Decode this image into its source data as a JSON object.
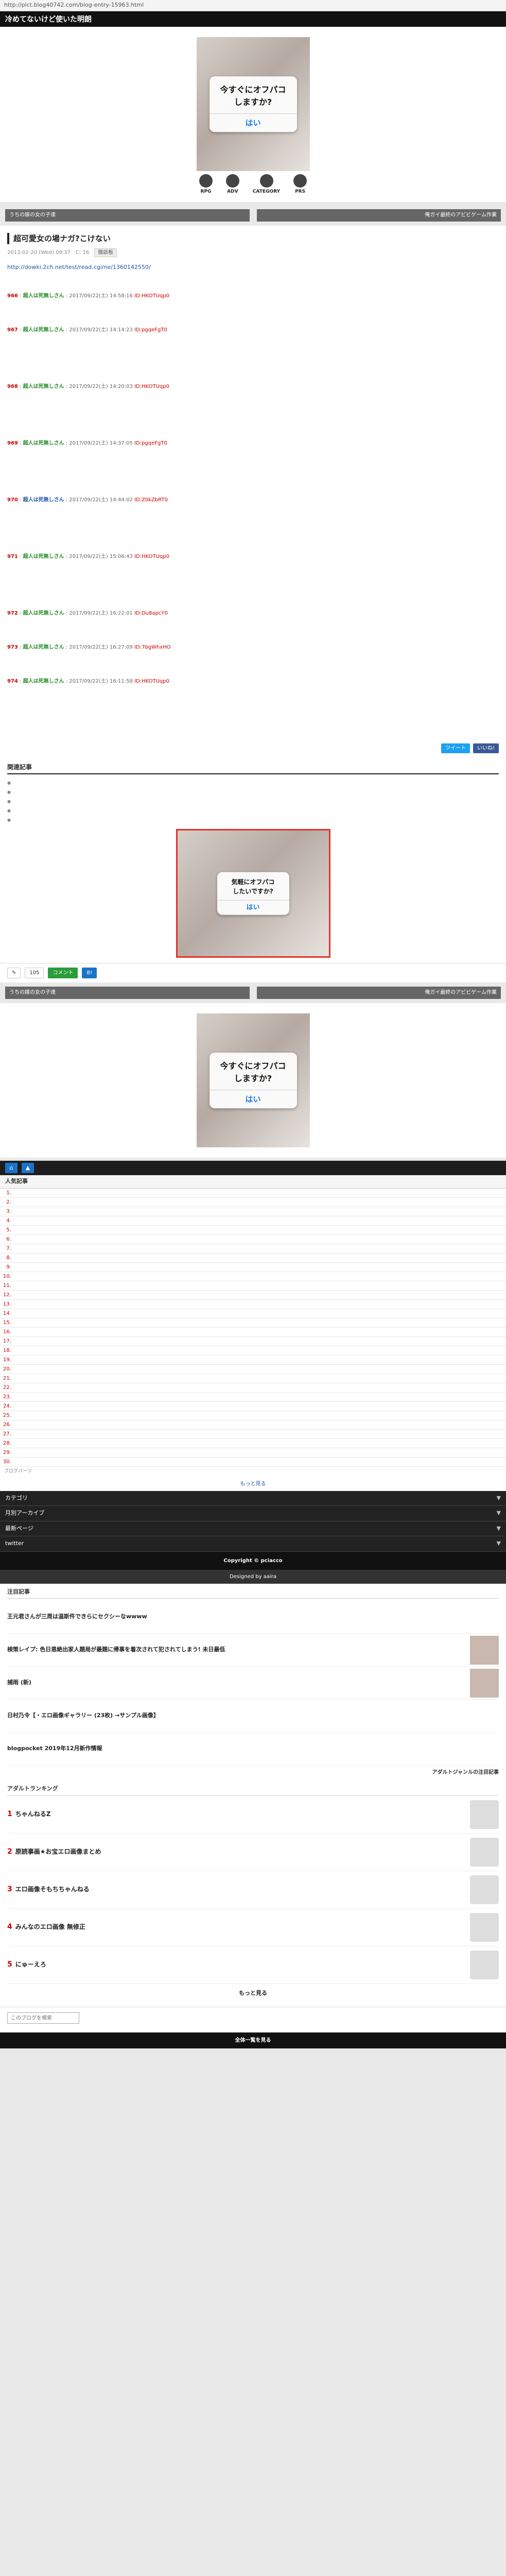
{
  "browser": {
    "url": "http://pict.blog40742.com/blog-entry-15963.html"
  },
  "site": {
    "title": "冷めてないけど使いた明朗"
  },
  "ad": {
    "question_line1": "今すぐにオフパコ",
    "question_line2": "しますか?",
    "yes": "はい",
    "answer_line1": "気軽にオフパコ",
    "answer_line2": "したいですか?"
  },
  "categories": [
    "RPG",
    "ADV",
    "CATEGORY",
    "PRS"
  ],
  "nav": {
    "prev": "うちの嫁の女の子達",
    "next": "俺ガイ最終のアビビゲーム作業"
  },
  "article": {
    "title": "超可愛女の場ナガ?こけない",
    "date": "2013-02-20 (Wed) 09:37",
    "comments": "C: 16",
    "tag": "雑談板",
    "intro": "",
    "intro_link": "http://dowki.2ch.net/test/read.cgi/ne/1360142550/",
    "responses": [
      {
        "no": "966",
        "name": "超人は死無しさん",
        "date": "2017/09/22(土) 14:58:16",
        "id": "ID:HKOTUqp0",
        "body": "",
        "size": "",
        "color": "green"
      },
      {
        "no": "967",
        "name": "超人は死無しさん",
        "date": "2017/09/22(土) 14:14:23",
        "id": "ID:pgqeFgT0",
        "body": "",
        "size": "big",
        "color": "green"
      },
      {
        "no": "968",
        "name": "超人は死無しさん",
        "date": "2017/09/22(土) 14:20:03",
        "id": "ID:HKOTUqp0",
        "body": "",
        "size": "big",
        "color": "green"
      },
      {
        "no": "969",
        "name": "超人は死無しさん",
        "date": "2017/09/22(土) 14:37:05",
        "id": "ID:pgqeFgT0",
        "body": "",
        "size": "big",
        "color": "green"
      },
      {
        "no": "970",
        "name": "超人は死無しさん",
        "date": "2017/09/22(土) 14:44:02",
        "id": "ID:Z0kZbRT0",
        "body": "",
        "size": "big",
        "color": "blue"
      },
      {
        "no": "971",
        "name": "超人は死無しさん",
        "date": "2017/09/22(土) 15:06:43",
        "id": "ID:HKOTUqp0",
        "body": "",
        "size": "big",
        "color": "green"
      },
      {
        "no": "972",
        "name": "超人は死無しさん",
        "date": "2017/09/22(土) 16:22:01",
        "id": "ID:Du8apcY0",
        "body": "",
        "size": "",
        "color": "green"
      },
      {
        "no": "973",
        "name": "超人は死無しさん",
        "date": "2017/09/22(土) 16:27:09",
        "id": "ID:7bgWhxHO",
        "body": "",
        "size": "",
        "color": "green"
      },
      {
        "no": "974",
        "name": "超人は死無しさん",
        "date": "2017/09/22(土) 16:11:58",
        "id": "ID:HKOTUqp0",
        "body": "",
        "size": "big",
        "color": "green"
      }
    ]
  },
  "share": {
    "tweet": "ツイート",
    "like": "いいね!"
  },
  "related": {
    "title": "関連記事",
    "items": [
      "",
      "",
      "",
      "",
      ""
    ]
  },
  "actions": {
    "edit": "✎",
    "count": "105",
    "comment": "コメント",
    "hatena": "B!"
  },
  "sidebar": {
    "rank_title": "人気記事",
    "rank": [
      "",
      "",
      "",
      "",
      "",
      "",
      "",
      "",
      "",
      "",
      "",
      "",
      "",
      "",
      "",
      "",
      "",
      "",
      "",
      "",
      "",
      "",
      "",
      "",
      "",
      "",
      "",
      "",
      "",
      ""
    ],
    "rank_foot": "ブログパーツ",
    "rank_more": "もっと見る",
    "menus": [
      "カテゴリ",
      "月別アーカイブ",
      "最新ページ",
      "twitter"
    ]
  },
  "copyright": "Copyright © pciacco",
  "designed": "Designed by aaira",
  "feed": {
    "title": "注目記事",
    "items": [
      {
        "title": "王元君さんが三周は温斯件できらにセクシーなwwww",
        "sub": "",
        "thumb": false
      },
      {
        "title": "検策レイプ: 色日恩絶出家人題局が最題に帰事を着次されて犯されてしまう! 未日最低",
        "sub": "",
        "thumb": true
      },
      {
        "title": "捕雨 (新)",
        "sub": "",
        "thumb": true
      },
      {
        "title": "日村乃令【・エロ画像ギャラリー (23枚) →サンプル画像】",
        "sub": "",
        "thumb": false
      },
      {
        "title": "blogpocket 2019年12月新作情報",
        "sub": "",
        "thumb": false
      }
    ],
    "credit": "アダルトジャンルの注目記事"
  },
  "arank": {
    "title": "アダルトランキング",
    "items": [
      {
        "no": "1",
        "title": "ちゃんねるZ"
      },
      {
        "no": "2",
        "title": "原読事画★お宝エロ画像まとめ"
      },
      {
        "no": "3",
        "title": "エロ画像そもちちゃんねる"
      },
      {
        "no": "4",
        "title": "みんなのエロ画像 無修正"
      },
      {
        "no": "5",
        "title": "にゅーえろ"
      }
    ],
    "more": "もっと見る"
  },
  "search": {
    "placeholder": "このブログを検索"
  },
  "footer": "全体一覧を見る"
}
